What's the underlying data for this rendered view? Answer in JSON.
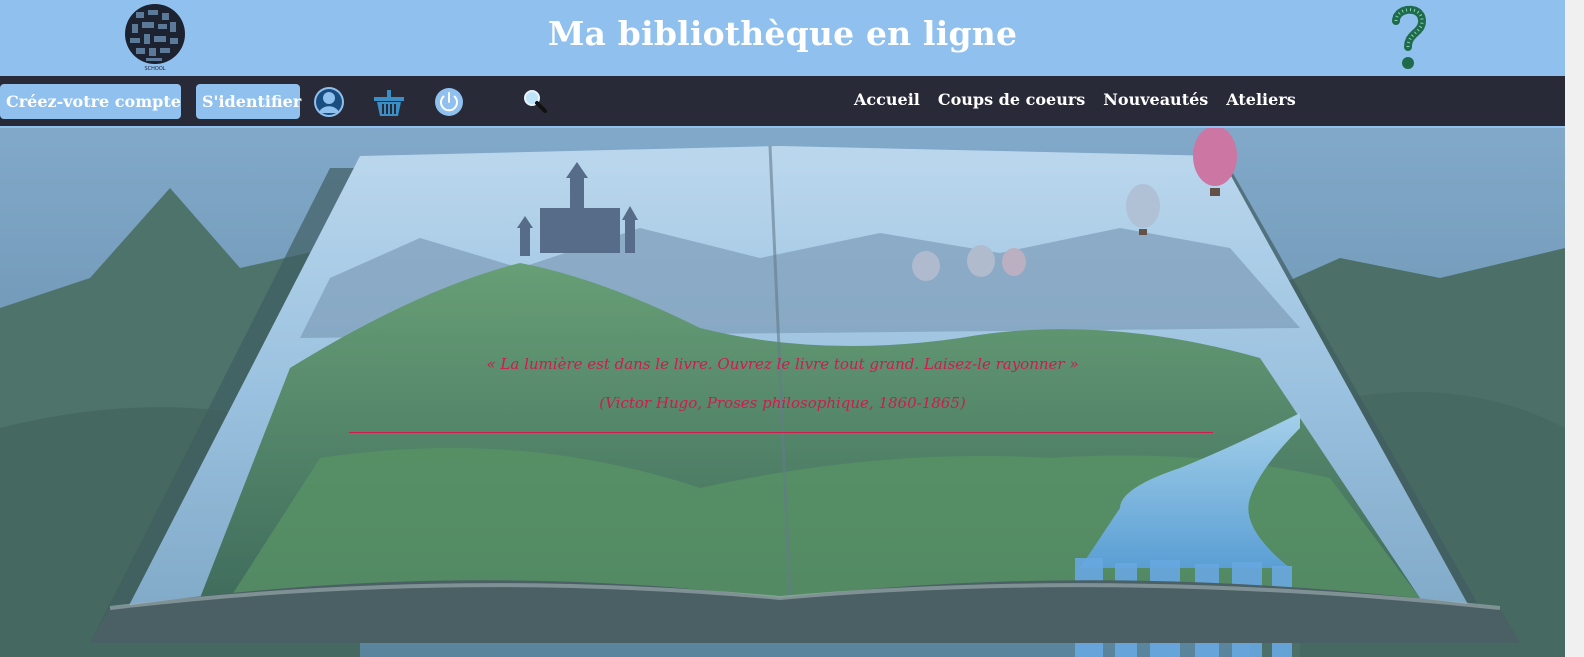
{
  "header": {
    "title": "Ma bibliothèque en ligne",
    "logo_icon": "school-globe-logo",
    "help_icon": "question-mark-icon",
    "background_color": "#8fc0ee"
  },
  "nav": {
    "create_account_label": "Créez-votre compte",
    "login_label": "S'identifier",
    "icons": [
      "user-icon",
      "basket-icon",
      "power-icon",
      "search-icon"
    ],
    "menu": [
      {
        "label": "Accueil"
      },
      {
        "label": "Coups de coeurs"
      },
      {
        "label": "Nouveautés"
      },
      {
        "label": "Ateliers"
      }
    ],
    "background_color": "#292a38"
  },
  "hero": {
    "quote": "« La lumière est dans le livre. Ouvrez le livre tout grand. Laisez-le rayonner »",
    "attribution": "(Victor Hugo, Proses philosophique, 1860-1865)",
    "quote_color": "#d11a4e",
    "image": "open-book-fantasy-landscape"
  }
}
